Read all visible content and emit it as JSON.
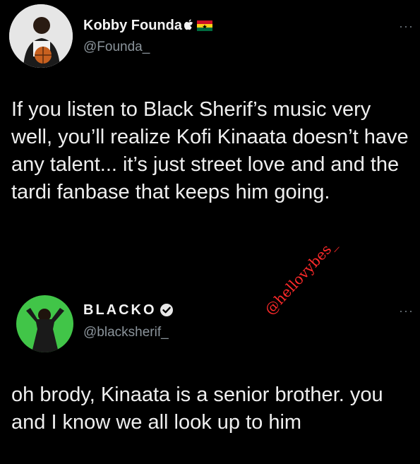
{
  "tweet1": {
    "display_name": "Kobby Founda",
    "handle": "@Founda_",
    "text": "If you listen to Black Sherif’s music very well, you’ll realize Kofi Kinaata doesn’t have any talent... it’s just street love and and the tardi fanbase that keeps him going.",
    "name_icons": [
      "apple-icon",
      "ghana-flag-icon"
    ]
  },
  "tweet2": {
    "display_name": "BLACKO",
    "handle": "@blacksherif_",
    "text": "oh brody, Kinaata is a senior brother. you and I know we all look up to him",
    "name_icons": [
      "verified-badge-icon"
    ]
  },
  "more_label": "···",
  "watermark": "@hellovybes_",
  "colors": {
    "background": "#000000",
    "text": "#efefef",
    "handle": "#8b949b",
    "watermark": "#ff2a2a",
    "flag": [
      "#ce1126",
      "#fcd116",
      "#006b3f"
    ]
  }
}
